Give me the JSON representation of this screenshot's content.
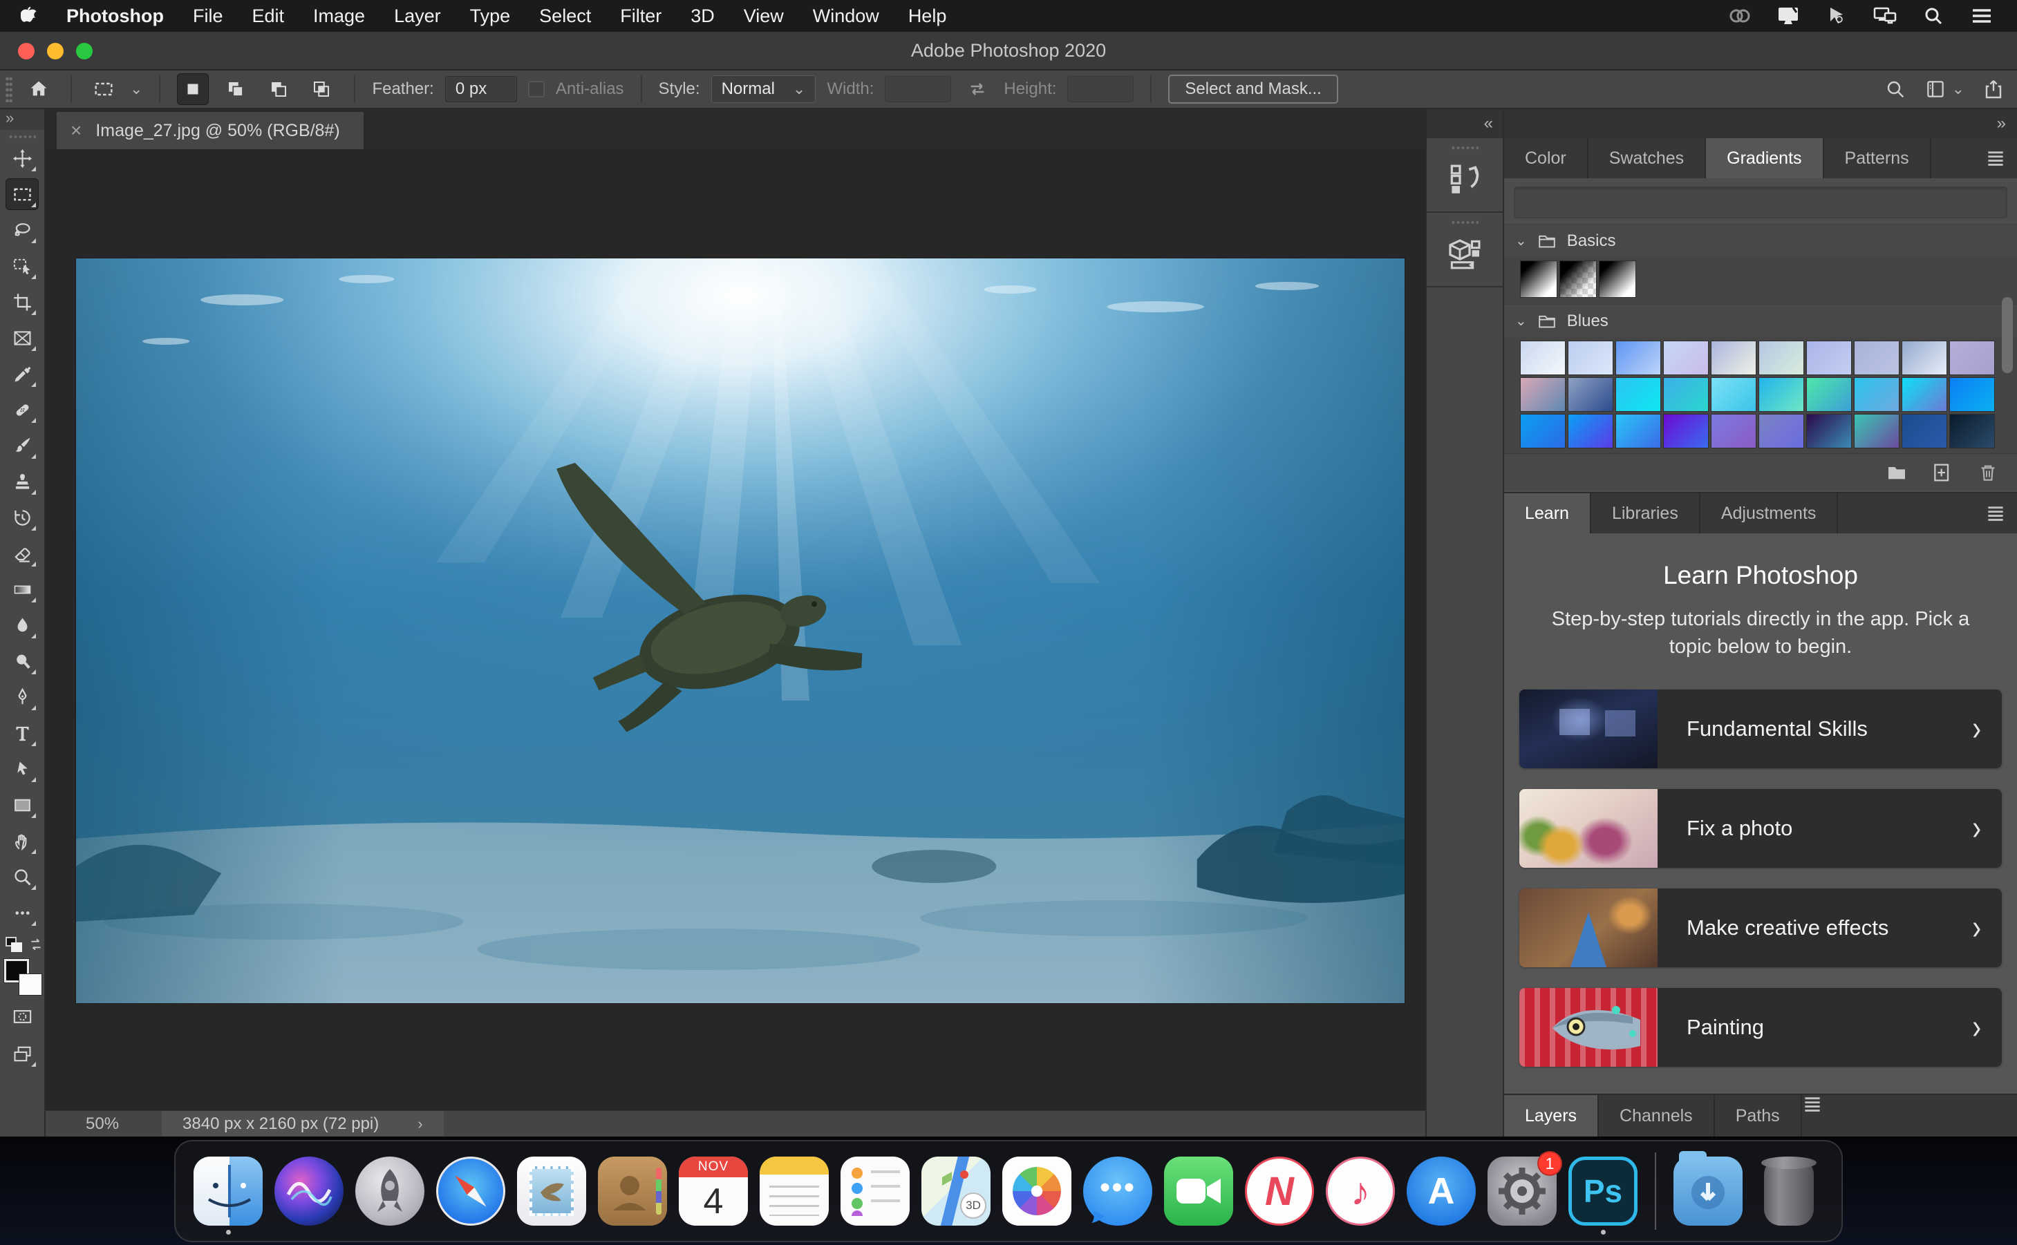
{
  "menu_bar": {
    "items": [
      "Photoshop",
      "File",
      "Edit",
      "Image",
      "Layer",
      "Type",
      "Select",
      "Filter",
      "3D",
      "View",
      "Window",
      "Help"
    ],
    "status_icons": [
      "creative-cloud",
      "display",
      "remote-cursor",
      "sidecar-displays",
      "spotlight",
      "notification-list"
    ]
  },
  "window": {
    "title": "Adobe Photoshop 2020"
  },
  "options_bar": {
    "feather_label": "Feather:",
    "feather_value": "0 px",
    "anti_alias_label": "Anti-alias",
    "style_label": "Style:",
    "style_value": "Normal",
    "width_label": "Width:",
    "height_label": "Height:",
    "select_mask_label": "Select and Mask..."
  },
  "document_tab": {
    "close": "×",
    "title": "Image_27.jpg @ 50% (RGB/8#)"
  },
  "toolbar": {
    "tools": [
      "Move Tool",
      "Rectangular Marquee Tool",
      "Lasso Tool",
      "Object Selection Tool",
      "Crop Tool",
      "Frame Tool",
      "Eyedropper Tool",
      "Spot Healing Brush Tool",
      "Brush Tool",
      "Clone Stamp Tool",
      "History Brush Tool",
      "Eraser Tool",
      "Gradient Tool",
      "Blur Tool",
      "Dodge Tool",
      "Pen Tool",
      "Horizontal Type Tool",
      "Path Selection Tool",
      "Rectangle Tool",
      "Hand Tool",
      "Zoom Tool",
      "Edit Toolbar",
      "Quick Mask Mode",
      "Screen Mode"
    ],
    "active_tool": "Rectangular Marquee Tool"
  },
  "status_bar": {
    "zoom": "50%",
    "dimensions": "3840 px x 2160 px (72 ppi)",
    "chevron": "›"
  },
  "right_panels": {
    "collapsed_icons": [
      "history",
      "3d-properties"
    ],
    "top_tabs": [
      "Color",
      "Swatches",
      "Gradients",
      "Patterns"
    ],
    "active_top_tab": "Gradients",
    "gradients": {
      "sections": [
        {
          "name": "Basics"
        },
        {
          "name": "Blues"
        }
      ],
      "basics_swatches": [
        "black-to-white",
        "black-to-transparent",
        "black-to-white"
      ],
      "blues_swatches": [
        [
          "#c9d8ee",
          "#f5f8fd"
        ],
        [
          "#bccdf0",
          "#dde8fa"
        ],
        [
          "#5f96f2",
          "#bcd4fa"
        ],
        [
          "#c4d7f7",
          "#cabcea"
        ],
        [
          "#aab5dc",
          "#eef0e6"
        ],
        [
          "#b6c7e3",
          "#d8eddd"
        ],
        [
          "#a9b5e8",
          "#c5cef2"
        ],
        [
          "#a9b3d9",
          "#bbc4e3"
        ],
        [
          "#94a9cd",
          "#e8eef9"
        ],
        [
          "#b4afd9",
          "#a89fcd"
        ],
        [
          "#d9a9b5",
          "#5f88b4"
        ],
        [
          "#8fa1c4",
          "#2b4b8d"
        ],
        [
          "#2ac4f1",
          "#10e7f1"
        ],
        [
          "#3bafe7",
          "#2bd7cf"
        ],
        [
          "#7be1f6",
          "#3bc4e9"
        ],
        [
          "#20b4eb",
          "#6fe7c4"
        ],
        [
          "#4fe7a9",
          "#3b9fd7"
        ],
        [
          "#2bc4eb",
          "#6fa9e1"
        ],
        [
          "#10dff6",
          "#6b7bd2"
        ],
        [
          "#0b7ff6",
          "#0baff1"
        ],
        [
          "#0b9ff1",
          "#2b6be7"
        ],
        [
          "#0b9ff6",
          "#5b3be7"
        ],
        [
          "#2ac4f9",
          "#3b6be7"
        ],
        [
          "#6b0bd2",
          "#3b6bf1"
        ],
        [
          "#7b7be1",
          "#8b5bc4"
        ],
        [
          "#7b83c4",
          "#6b6be1"
        ],
        [
          "#2b0b4b",
          "#3b8bb4"
        ],
        [
          "#3bc4b4",
          "#6b4b9f"
        ],
        [
          "#1b4b8d",
          "#2b5ba9"
        ],
        [
          "#0b1b2b",
          "#2b4b6b"
        ]
      ]
    },
    "learn": {
      "tabs": [
        "Learn",
        "Libraries",
        "Adjustments"
      ],
      "active_tab": "Learn",
      "title": "Learn Photoshop",
      "subtitle": "Step-by-step tutorials directly in the app. Pick a topic below to begin.",
      "cards": [
        {
          "label": "Fundamental Skills"
        },
        {
          "label": "Fix a photo"
        },
        {
          "label": "Make creative effects"
        },
        {
          "label": "Painting"
        }
      ],
      "card_chevron": "›"
    },
    "bottom_tabs": [
      "Layers",
      "Channels",
      "Paths"
    ],
    "active_bottom_tab": "Layers"
  },
  "ui": {
    "collapse_left": "«",
    "expand_right": "»",
    "section_chevron": "⌄",
    "dropdown_chevron": "⌄"
  },
  "dock": {
    "apps": [
      {
        "name": "Finder",
        "running": true
      },
      {
        "name": "Siri"
      },
      {
        "name": "Launchpad"
      },
      {
        "name": "Safari"
      },
      {
        "name": "Mail"
      },
      {
        "name": "Contacts"
      },
      {
        "name": "Calendar",
        "month": "NOV",
        "day": "4"
      },
      {
        "name": "Notes"
      },
      {
        "name": "Reminders"
      },
      {
        "name": "Maps",
        "badge_3d": "3D"
      },
      {
        "name": "Photos"
      },
      {
        "name": "Messages",
        "dots": "•••"
      },
      {
        "name": "FaceTime"
      },
      {
        "name": "News",
        "glyph": "N"
      },
      {
        "name": "iTunes",
        "glyph": "♪"
      },
      {
        "name": "App Store",
        "glyph": "A"
      },
      {
        "name": "System Preferences",
        "badge": "1"
      },
      {
        "name": "Photoshop",
        "glyph": "Ps",
        "running": true
      },
      {
        "name": "Downloads"
      },
      {
        "name": "Trash"
      }
    ]
  },
  "colors": {
    "ps_cyan": "#2fb9ea",
    "badge_red": "#ff3b30",
    "traffic_red": "#ff5f57",
    "traffic_yellow": "#febc2e",
    "traffic_green": "#28c840"
  }
}
